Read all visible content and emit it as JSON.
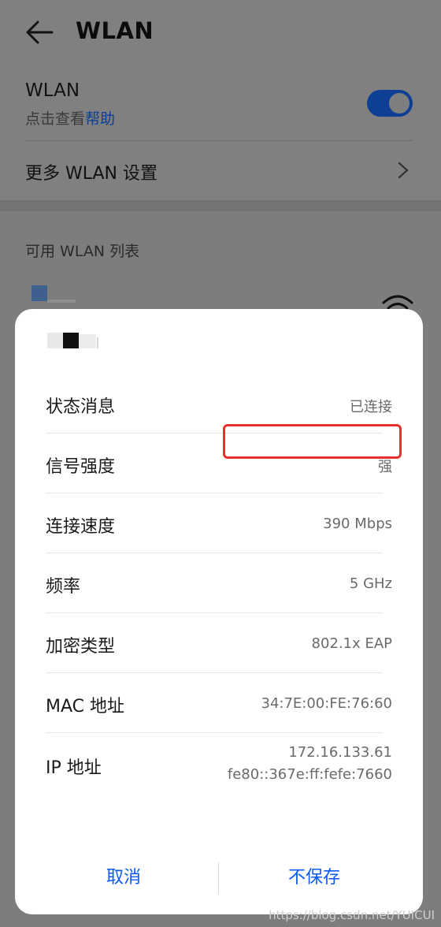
{
  "header": {
    "title": "WLAN"
  },
  "wlan": {
    "label": "WLAN",
    "subtitle_prefix": "点击查看",
    "subtitle_link": "帮助",
    "toggle_on": true
  },
  "more_settings": {
    "label": "更多 WLAN 设置"
  },
  "list": {
    "title": "可用 WLAN 列表"
  },
  "dialog": {
    "rows": [
      {
        "key": "状态消息",
        "value": "已连接"
      },
      {
        "key": "信号强度",
        "value": "强"
      },
      {
        "key": "连接速度",
        "value": "390 Mbps"
      },
      {
        "key": "频率",
        "value": "5 GHz"
      },
      {
        "key": "加密类型",
        "value": "802.1x EAP"
      },
      {
        "key": "MAC 地址",
        "value": "34:7E:00:FE:76:60"
      }
    ],
    "ip": {
      "key": "IP 地址",
      "ipv4": "172.16.133.61",
      "ipv6": "fe80::367e:ff:fefe:7660"
    },
    "cancel_label": "取消",
    "nosave_label": "不保存"
  },
  "watermark": "https://blog.csdn.net/YUICUI",
  "colors": {
    "accent": "#0a59f7",
    "highlight": "#e8302a",
    "toggle_on": "#0f3f95"
  }
}
